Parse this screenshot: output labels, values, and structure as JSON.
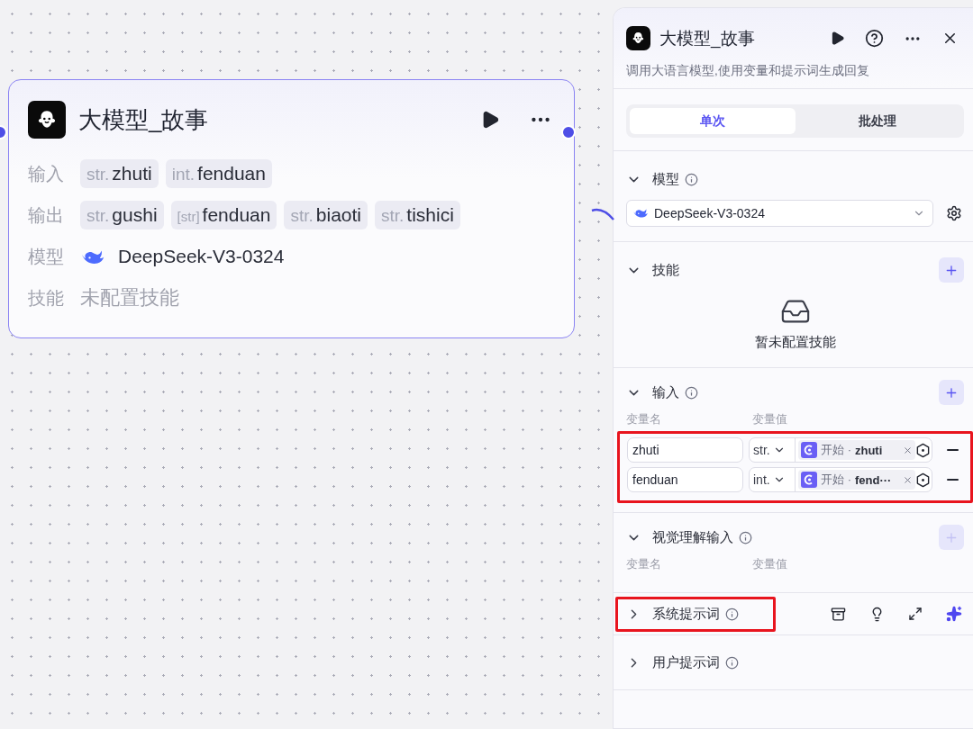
{
  "node": {
    "title": "大模型_故事",
    "rows": [
      {
        "label": "输入",
        "kind": "tags",
        "tags": [
          {
            "type": "str.",
            "name": "zhuti"
          },
          {
            "type": "int.",
            "name": "fenduan"
          }
        ]
      },
      {
        "label": "输出",
        "kind": "tags",
        "tags": [
          {
            "type": "str.",
            "name": "gushi"
          },
          {
            "type": "[str]",
            "name": "fenduan"
          },
          {
            "type": "str.",
            "name": "biaoti"
          },
          {
            "type": "str.",
            "name": "tishici"
          }
        ]
      },
      {
        "label": "模型",
        "kind": "model",
        "value": "DeepSeek-V3-0324"
      },
      {
        "label": "技能",
        "kind": "empty",
        "value": "未配置技能"
      }
    ]
  },
  "panel": {
    "title": "大模型_故事",
    "description": "调用大语言模型,使用变量和提示词生成回复",
    "tabs": [
      {
        "label": "单次",
        "selected": true
      },
      {
        "label": "批处理",
        "selected": false
      }
    ],
    "sections": [
      {
        "kind": "model",
        "title": "模型",
        "expanded": true,
        "info": true,
        "model": "DeepSeek-V3-0324"
      },
      {
        "kind": "skills",
        "title": "技能",
        "expanded": true,
        "info": false,
        "add_button": {
          "disabled": false
        },
        "empty_text": "暂未配置技能"
      },
      {
        "kind": "inputs",
        "title": "输入",
        "expanded": true,
        "info": true,
        "highlighted": true,
        "add_button": {
          "disabled": false
        },
        "columns": [
          "变量名",
          "变量值"
        ],
        "rows": [
          {
            "name": "zhuti",
            "type": "str.",
            "source": "开始",
            "separator": "·",
            "ref": "zhuti"
          },
          {
            "name": "fenduan",
            "type": "int.",
            "source": "开始",
            "separator": "·",
            "ref": "fend···"
          }
        ]
      },
      {
        "kind": "inputs",
        "title": "视觉理解输入",
        "expanded": true,
        "info": true,
        "highlighted": false,
        "add_button": {
          "disabled": true
        },
        "columns": [
          "变量名",
          "变量值"
        ]
      },
      {
        "kind": "prompt",
        "title": "系统提示词",
        "expanded": false,
        "info": true,
        "highlighted": true,
        "tools": true
      },
      {
        "kind": "prompt",
        "title": "用户提示词",
        "expanded": false,
        "info": true,
        "highlighted": false,
        "tools": false
      }
    ]
  }
}
